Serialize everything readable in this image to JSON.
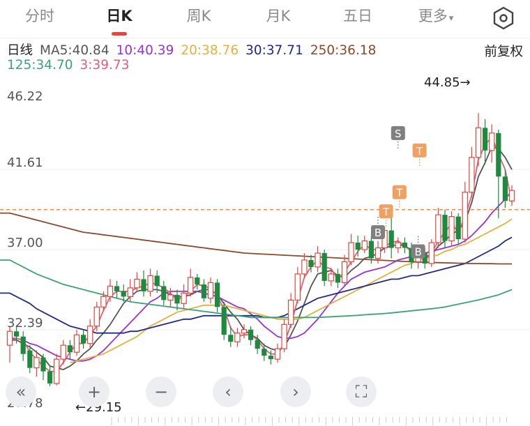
{
  "tabs": [
    {
      "label": "分时",
      "active": false
    },
    {
      "label": "日K",
      "active": true
    },
    {
      "label": "周K",
      "active": false
    },
    {
      "label": "月K",
      "active": false
    },
    {
      "label": "五日",
      "active": false
    },
    {
      "label": "更多",
      "active": false
    }
  ],
  "more_caret": "▾",
  "settings_icon": "hexagon-settings-icon",
  "indicator": {
    "period_label": "日线",
    "ma": [
      {
        "label": "MA5:40.84",
        "color": "#555555"
      },
      {
        "label": "10:40.39",
        "color": "#9b30d9"
      },
      {
        "label": "20:38.76",
        "color": "#e2b33c"
      },
      {
        "label": "30:37.71",
        "color": "#1f2a8a"
      },
      {
        "label": "250:36.18",
        "color": "#8b4a2b"
      },
      {
        "label": "125:34.70",
        "color": "#3aa37a"
      },
      {
        "label": "3:39.73",
        "color": "#e0607a"
      }
    ],
    "adjust_label": "前复权"
  },
  "chart_data": {
    "type": "candlestick",
    "ylim": [
      27.78,
      46.22
    ],
    "y_ticks": [
      "46.22",
      "41.61",
      "37.00",
      "32.39",
      "27.78"
    ],
    "high_annotation": {
      "label": "44.85→",
      "value": 44.85
    },
    "low_annotation": {
      "label": "←29.15",
      "value": 29.15
    },
    "last_price_line": 39.3,
    "markers": [
      {
        "label": "S",
        "index": 58,
        "value": 43.7
      },
      {
        "label": "T",
        "index": 61,
        "value": 42.7
      },
      {
        "label": "T",
        "index": 58,
        "value": 40.3
      },
      {
        "label": "T",
        "index": 56,
        "value": 39.2
      },
      {
        "label": "B",
        "index": 55,
        "value": 38.0
      },
      {
        "label": "B",
        "index": 61,
        "value": 36.9
      }
    ],
    "candles": [
      [
        31.5,
        32.3,
        30.5,
        32.6
      ],
      [
        32.3,
        32.0,
        31.6,
        32.6
      ],
      [
        32.0,
        31.0,
        30.6,
        32.3
      ],
      [
        31.2,
        30.2,
        29.9,
        31.5
      ],
      [
        30.2,
        30.8,
        29.7,
        31.2
      ],
      [
        30.8,
        30.0,
        29.5,
        31.0
      ],
      [
        30.0,
        29.3,
        29.15,
        30.3
      ],
      [
        29.3,
        30.7,
        29.2,
        31.0
      ],
      [
        30.7,
        31.5,
        30.4,
        31.8
      ],
      [
        31.5,
        31.1,
        30.7,
        31.8
      ],
      [
        31.1,
        32.1,
        30.9,
        32.4
      ],
      [
        32.1,
        31.6,
        31.3,
        32.4
      ],
      [
        31.6,
        32.6,
        31.3,
        33.0
      ],
      [
        32.6,
        33.7,
        32.3,
        34.0
      ],
      [
        33.7,
        34.3,
        33.5,
        34.6
      ],
      [
        34.3,
        34.9,
        34.0,
        35.3
      ],
      [
        34.9,
        34.6,
        34.2,
        35.2
      ],
      [
        34.6,
        34.3,
        34.0,
        35.0
      ],
      [
        34.3,
        34.8,
        34.0,
        35.3
      ],
      [
        34.8,
        35.3,
        34.6,
        35.7
      ],
      [
        35.3,
        34.6,
        34.3,
        35.8
      ],
      [
        34.6,
        35.5,
        34.3,
        35.9
      ],
      [
        35.5,
        34.9,
        34.5,
        35.8
      ],
      [
        34.9,
        34.1,
        33.8,
        35.2
      ],
      [
        34.1,
        34.4,
        33.7,
        34.8
      ],
      [
        34.4,
        33.9,
        33.5,
        34.7
      ],
      [
        33.9,
        34.5,
        33.6,
        35.0
      ],
      [
        34.5,
        35.4,
        34.3,
        35.9
      ],
      [
        35.4,
        35.0,
        34.7,
        35.6
      ],
      [
        35.0,
        34.2,
        34.0,
        35.3
      ],
      [
        34.2,
        35.1,
        33.9,
        35.4
      ],
      [
        35.1,
        33.7,
        33.4,
        35.3
      ],
      [
        33.7,
        32.1,
        31.8,
        34.0
      ],
      [
        32.1,
        31.7,
        31.4,
        32.6
      ],
      [
        31.7,
        32.2,
        31.4,
        32.5
      ],
      [
        32.2,
        32.4,
        31.9,
        32.7
      ],
      [
        32.4,
        31.8,
        31.5,
        32.6
      ],
      [
        31.8,
        31.3,
        31.0,
        32.1
      ],
      [
        31.3,
        30.9,
        30.6,
        31.6
      ],
      [
        30.9,
        30.7,
        30.4,
        31.2
      ],
      [
        30.7,
        31.3,
        30.5,
        31.6
      ],
      [
        31.3,
        32.7,
        31.1,
        33.0
      ],
      [
        32.7,
        34.1,
        32.5,
        34.5
      ],
      [
        34.1,
        35.6,
        33.9,
        36.0
      ],
      [
        35.6,
        36.4,
        35.4,
        36.8
      ],
      [
        36.4,
        36.0,
        35.7,
        36.7
      ],
      [
        36.0,
        36.8,
        35.7,
        37.2
      ],
      [
        36.8,
        35.2,
        34.9,
        37.0
      ],
      [
        35.2,
        35.6,
        34.9,
        35.9
      ],
      [
        35.6,
        35.1,
        34.8,
        35.9
      ],
      [
        35.1,
        36.3,
        34.9,
        36.7
      ],
      [
        36.3,
        37.4,
        36.1,
        37.9
      ],
      [
        37.4,
        37.0,
        36.6,
        37.8
      ],
      [
        37.0,
        37.5,
        36.8,
        37.8
      ],
      [
        37.5,
        36.5,
        36.2,
        37.8
      ],
      [
        36.5,
        37.1,
        36.2,
        37.5
      ],
      [
        37.1,
        38.1,
        36.8,
        38.3
      ],
      [
        38.1,
        37.1,
        36.5,
        39.2
      ],
      [
        37.1,
        37.4,
        36.8,
        37.7
      ],
      [
        37.4,
        37.1,
        36.8,
        37.7
      ],
      [
        37.1,
        36.3,
        35.9,
        37.4
      ],
      [
        36.3,
        36.8,
        35.9,
        37.2
      ],
      [
        36.8,
        36.2,
        35.9,
        37.1
      ],
      [
        36.2,
        37.4,
        36.0,
        37.6
      ],
      [
        37.4,
        39.0,
        37.1,
        39.4
      ],
      [
        39.0,
        37.5,
        37.1,
        39.3
      ],
      [
        37.5,
        38.9,
        37.2,
        39.2
      ],
      [
        38.9,
        37.6,
        37.3,
        39.1
      ],
      [
        37.6,
        40.3,
        37.4,
        40.9
      ],
      [
        40.3,
        42.3,
        40.0,
        42.9
      ],
      [
        42.3,
        44.0,
        41.8,
        44.85
      ],
      [
        44.0,
        42.7,
        41.9,
        44.5
      ],
      [
        42.7,
        43.7,
        42.0,
        44.2
      ],
      [
        43.7,
        41.2,
        38.8,
        43.9
      ],
      [
        41.2,
        39.8,
        39.4,
        41.6
      ],
      [
        39.8,
        40.4,
        39.5,
        40.7
      ]
    ],
    "ma_series": [
      {
        "name": "MA5",
        "color": "#555555",
        "values": [
          31.8,
          31.8,
          31.6,
          31.4,
          31.1,
          30.8,
          30.3,
          30.2,
          30.1,
          30.3,
          30.6,
          31.0,
          31.3,
          31.8,
          32.2,
          32.7,
          33.3,
          33.9,
          34.3,
          34.6,
          34.7,
          34.7,
          34.7,
          34.6,
          34.4,
          34.3,
          34.3,
          34.4,
          34.6,
          34.7,
          34.7,
          34.4,
          33.9,
          33.4,
          33.0,
          32.4,
          32.1,
          31.9,
          31.5,
          31.3,
          31.2,
          31.4,
          32.1,
          32.9,
          33.9,
          34.9,
          35.6,
          35.7,
          35.8,
          35.5,
          35.4,
          35.8,
          36.1,
          36.5,
          36.6,
          36.8,
          37.1,
          37.2,
          37.3,
          37.2,
          37.0,
          36.8,
          36.6,
          36.7,
          37.2,
          37.5,
          37.9,
          38.1,
          38.6,
          39.7,
          41.2,
          42.0,
          42.9,
          42.8,
          42.3,
          41.6
        ]
      },
      {
        "name": "MA10",
        "color": "#9b30d9",
        "values": [
          31.9,
          31.9,
          31.8,
          31.6,
          31.5,
          31.3,
          31.1,
          30.9,
          30.8,
          30.7,
          30.6,
          30.6,
          30.7,
          30.9,
          31.2,
          31.6,
          32.0,
          32.4,
          32.8,
          33.2,
          33.6,
          34.0,
          34.2,
          34.5,
          34.6,
          34.6,
          34.6,
          34.6,
          34.6,
          34.5,
          34.4,
          34.3,
          34.1,
          33.9,
          33.7,
          33.6,
          33.3,
          33.0,
          32.6,
          32.3,
          32.0,
          31.9,
          31.9,
          32.0,
          32.2,
          32.6,
          33.0,
          33.5,
          34.0,
          34.5,
          34.9,
          35.3,
          35.5,
          35.7,
          35.8,
          35.9,
          36.0,
          36.2,
          36.4,
          36.5,
          36.6,
          36.7,
          36.8,
          36.9,
          37.0,
          37.1,
          37.2,
          37.3,
          37.5,
          37.8,
          38.2,
          38.6,
          39.1,
          39.5,
          39.9,
          40.39
        ]
      },
      {
        "name": "MA20",
        "color": "#e2b33c",
        "values": [
          null,
          null,
          null,
          null,
          null,
          null,
          null,
          null,
          null,
          30.5,
          30.6,
          30.7,
          30.8,
          30.9,
          31.0,
          31.2,
          31.4,
          31.6,
          31.8,
          32.0,
          32.3,
          32.6,
          32.8,
          33.0,
          33.2,
          33.4,
          33.5,
          33.6,
          33.7,
          33.8,
          33.8,
          33.8,
          33.8,
          33.7,
          33.6,
          33.5,
          33.4,
          33.3,
          33.2,
          33.1,
          33.0,
          33.0,
          33.0,
          33.0,
          33.1,
          33.3,
          33.5,
          33.7,
          33.9,
          34.1,
          34.3,
          34.5,
          34.7,
          34.9,
          35.1,
          35.3,
          35.5,
          35.7,
          35.9,
          36.1,
          36.2,
          36.4,
          36.5,
          36.6,
          36.7,
          36.9,
          37.0,
          37.2,
          37.3,
          37.5,
          37.7,
          37.9,
          38.1,
          38.3,
          38.5,
          38.76
        ]
      },
      {
        "name": "MA30",
        "color": "#1f2a8a",
        "values": [
          34.5,
          34.3,
          34.1,
          33.9,
          33.6,
          33.4,
          33.2,
          33.0,
          32.8,
          32.6,
          32.5,
          32.4,
          32.3,
          32.2,
          32.2,
          32.2,
          32.2,
          32.2,
          32.3,
          32.3,
          32.4,
          32.5,
          32.6,
          32.7,
          32.8,
          32.9,
          33.0,
          33.0,
          33.1,
          33.2,
          33.2,
          33.2,
          33.2,
          33.2,
          33.2,
          33.2,
          33.2,
          33.2,
          33.1,
          33.1,
          33.1,
          33.2,
          33.4,
          33.6,
          33.8,
          34.0,
          34.2,
          34.3,
          34.4,
          34.5,
          34.6,
          34.7,
          34.8,
          34.9,
          35.0,
          35.1,
          35.2,
          35.3,
          35.3,
          35.4,
          35.5,
          35.5,
          35.6,
          35.7,
          35.8,
          35.9,
          36.0,
          36.1,
          36.2,
          36.4,
          36.6,
          36.8,
          37.0,
          37.2,
          37.5,
          37.71
        ]
      },
      {
        "name": "MA250",
        "color": "#8b4a2b",
        "values": [
          39.1,
          39.0,
          38.9,
          38.8,
          38.7,
          38.6,
          38.5,
          38.4,
          38.3,
          38.2,
          38.1,
          38.0,
          37.95,
          37.9,
          37.85,
          37.8,
          37.75,
          37.7,
          37.65,
          37.6,
          37.55,
          37.5,
          37.45,
          37.4,
          37.35,
          37.3,
          37.25,
          37.2,
          37.15,
          37.1,
          37.05,
          37.0,
          36.95,
          36.9,
          36.85,
          36.8,
          36.78,
          36.76,
          36.74,
          36.72,
          36.7,
          36.68,
          36.66,
          36.64,
          36.62,
          36.6,
          36.58,
          36.56,
          36.54,
          36.52,
          36.5,
          36.48,
          36.46,
          36.44,
          36.42,
          36.4,
          36.38,
          36.36,
          36.34,
          36.32,
          36.3,
          36.28,
          36.27,
          36.26,
          36.25,
          36.24,
          36.23,
          36.22,
          36.21,
          36.2,
          36.2,
          36.19,
          36.19,
          36.18,
          36.18,
          36.18
        ]
      },
      {
        "name": "MA125",
        "color": "#3aa37a",
        "values": [
          36.4,
          36.2,
          36.0,
          35.8,
          35.6,
          35.45,
          35.3,
          35.15,
          35.0,
          34.9,
          34.8,
          34.7,
          34.6,
          34.5,
          34.4,
          34.3,
          34.2,
          34.1,
          34.0,
          33.95,
          33.9,
          33.85,
          33.8,
          33.75,
          33.7,
          33.65,
          33.6,
          33.55,
          33.5,
          33.45,
          33.4,
          33.35,
          33.3,
          33.25,
          33.2,
          33.15,
          33.1,
          33.1,
          33.1,
          33.1,
          33.1,
          33.1,
          33.1,
          33.1,
          33.1,
          33.1,
          33.1,
          33.12,
          33.14,
          33.16,
          33.18,
          33.2,
          33.22,
          33.25,
          33.28,
          33.3,
          33.33,
          33.36,
          33.4,
          33.44,
          33.48,
          33.52,
          33.56,
          33.6,
          33.65,
          33.7,
          33.78,
          33.86,
          33.94,
          34.02,
          34.1,
          34.2,
          34.3,
          34.4,
          34.55,
          34.7
        ]
      },
      {
        "name": "MA3",
        "color": "#e0607a",
        "values": [
          31.8,
          31.9,
          31.8,
          31.1,
          30.7,
          30.3,
          30.0,
          30.0,
          30.5,
          31.1,
          31.6,
          31.6,
          32.1,
          32.6,
          33.5,
          34.3,
          34.6,
          34.6,
          34.6,
          34.8,
          34.9,
          35.1,
          35.0,
          34.8,
          34.5,
          34.1,
          34.3,
          34.6,
          35.0,
          34.9,
          34.8,
          34.3,
          33.6,
          32.5,
          32.0,
          32.1,
          32.1,
          31.8,
          31.3,
          31.0,
          31.0,
          31.6,
          32.7,
          34.1,
          35.4,
          36.0,
          36.4,
          36.0,
          35.9,
          35.3,
          35.7,
          36.3,
          36.9,
          37.3,
          37.0,
          37.0,
          37.2,
          37.4,
          37.5,
          37.2,
          36.9,
          36.7,
          36.4,
          36.8,
          37.5,
          38.0,
          38.5,
          38.0,
          38.9,
          40.1,
          42.2,
          43.0,
          43.5,
          42.5,
          41.6,
          39.73
        ]
      }
    ]
  },
  "controls": [
    {
      "name": "collapse-left-button",
      "glyph": "«"
    },
    {
      "name": "zoom-in-button",
      "glyph": "+"
    },
    {
      "name": "zoom-out-button",
      "glyph": "−"
    },
    {
      "name": "prev-button",
      "glyph": "‹"
    },
    {
      "name": "next-button",
      "glyph": "›"
    },
    {
      "name": "fullscreen-button",
      "glyph": "⛶"
    }
  ],
  "colors": {
    "up": "#e8453c",
    "down": "#1e8a3e",
    "marker_S": "#808080",
    "marker_T": "#f0a060",
    "marker_B": "#808080",
    "last_price": "#f08a30"
  }
}
